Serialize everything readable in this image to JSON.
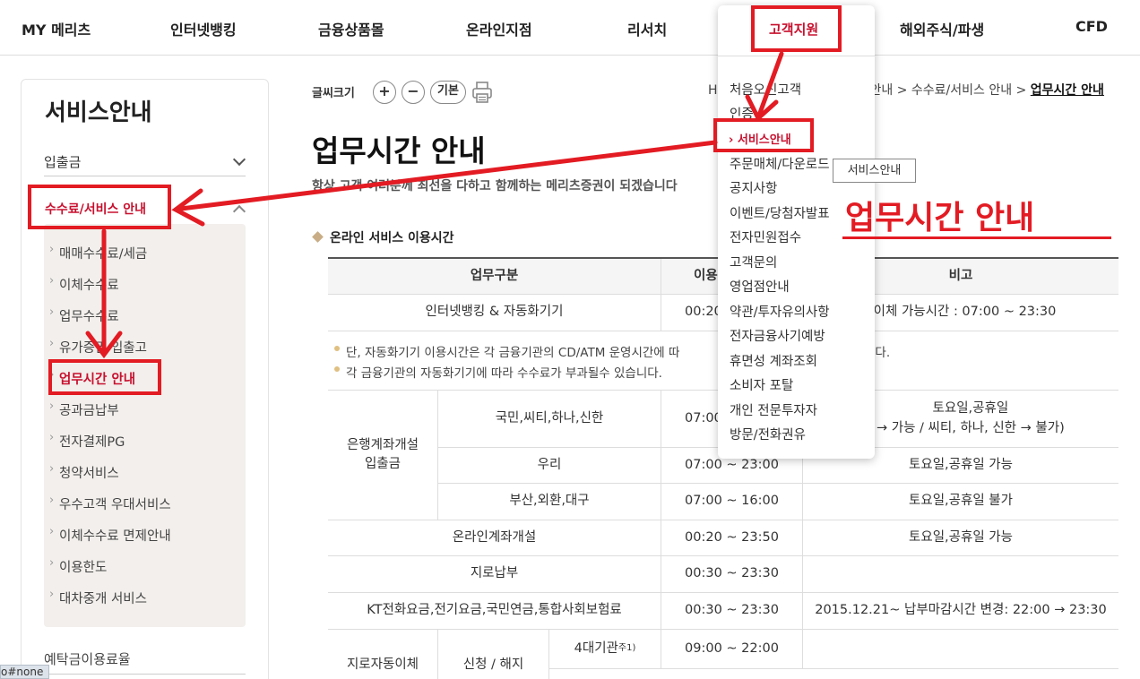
{
  "gnb": {
    "items": [
      "MY 메리츠",
      "인터넷뱅킹",
      "금융상품몰",
      "온라인지점",
      "리서치",
      "고객지원",
      "해외주식/파생",
      "CFD"
    ]
  },
  "lnb": {
    "title": "서비스안내",
    "menus": [
      "입출금",
      "수수료/서비스 안내"
    ],
    "sub_items": [
      "매매수수료/세금",
      "이체수수료",
      "업무수수료",
      "유가증권 입출고",
      "업무시간 안내",
      "공과금납부",
      "전자결제PG",
      "청약서비스",
      "우수고객 우대서비스",
      "이체수수료 면제안내",
      "이용한도",
      "대차중개 서비스"
    ],
    "bottom_item": "예탁금이용료율"
  },
  "util": {
    "font_label": "글씨크기",
    "plus": "+",
    "minus": "−",
    "default": "기본",
    "print_icon": "printer-icon"
  },
  "breadcrumb": {
    "prefix": "H",
    "mid": "안내 > 수수료/서비스 안내 > ",
    "current": "업무시간 안내"
  },
  "page": {
    "title": "업무시간 안내",
    "desc": "항상 고객 여러분께 최선을 다하고 함께하는 메리츠증권이 되겠습니다"
  },
  "section": {
    "title": "온라인 서비스 이용시간"
  },
  "table": {
    "headers": [
      "업무구분",
      "이용",
      "비고"
    ],
    "r1": {
      "name": "인터넷뱅킹 & 자동화기기",
      "time": "00:20",
      "note": "타행이체 가능시간 : 07:00 ~ 23:30"
    },
    "notes": [
      "단, 자동화기기 이용시간은 각 금융기관의 CD/ATM 운영시간에 따",
      "니다.",
      "각 금융기관의 자동화기기에 따라 수수료가 부과될수 있습니다."
    ],
    "bank_group": "은행계좌개설\n입출금",
    "bank_rows": [
      {
        "name": "국민,씨티,하나,신한",
        "time": "07:00",
        "note": "토요일,공휴일\n→ 가능 / 씨티, 하나, 신한 → 불가)"
      },
      {
        "name": "우리",
        "time": "07:00 ~ 23:00",
        "note": "토요일,공휴일 가능"
      },
      {
        "name": "부산,외환,대구",
        "time": "07:00 ~ 16:00",
        "note": "토요일,공휴일 불가"
      }
    ],
    "r_online": {
      "name": "온라인계좌개설",
      "time": "00:20 ~ 23:50",
      "note": "토요일,공휴일 가능"
    },
    "r_giro": {
      "name": "지로납부",
      "time": "00:30 ~ 23:30",
      "note": ""
    },
    "r_kt": {
      "name": "KT전화요금,전기요금,국민연금,통합사회보험료",
      "time": "00:30 ~ 23:30",
      "note": "2015.12.21~ 납부마감시간 변경: 22:00 → 23:30"
    },
    "r_auto": {
      "group": "지로자동이체",
      "sub": "신청 / 해지",
      "name": "4대기관",
      "sup": "주1)",
      "time": "09:00 ~ 22:00"
    }
  },
  "dropdown": {
    "head": "고객지원",
    "items": [
      "처음오신고객",
      "인증",
      "서비스안내",
      "주문매체/다운로드",
      "공지사항",
      "이벤트/당첨자발표",
      "전자민원접수",
      "고객문의",
      "영업점안내",
      "약관/투자유의사항",
      "전자금융사기예방",
      "휴면성 계좌조회",
      "소비자 포탈",
      "개인 전문투자자",
      "방문/전화권유"
    ],
    "active_prefix": "› ",
    "tooltip": "서비스안내"
  },
  "annotation": {
    "title": "업무시간 안내",
    "color": "#e31b23"
  },
  "status_bar": "o#none",
  "colors": {
    "brand": "#c8102e",
    "annotation": "#e31b23",
    "submenu_bg": "#f2efec"
  }
}
